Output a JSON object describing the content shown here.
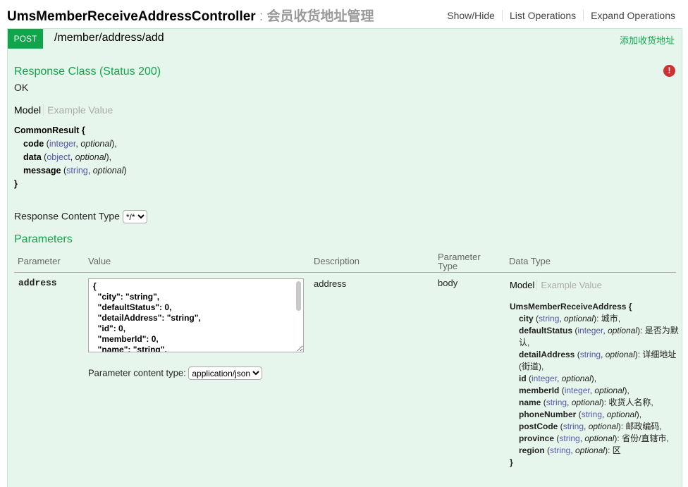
{
  "header": {
    "controller": "UmsMemberReceiveAddressController",
    "separator": " : ",
    "description": "会员收货地址管理",
    "links": [
      "Show/Hide",
      "List Operations",
      "Expand Operations"
    ]
  },
  "operation": {
    "method": "POST",
    "path": "/member/address/add",
    "summary": "添加收货地址"
  },
  "response": {
    "heading": "Response Class (Status 200)",
    "status_text": "OK",
    "tabs": [
      "Model",
      "Example Value"
    ],
    "model_name": "CommonResult {",
    "fields": [
      {
        "name": "code",
        "type": "integer",
        "opt": "optional",
        "end": "),"
      },
      {
        "name": "data",
        "type": "object",
        "opt": "optional",
        "end": "),"
      },
      {
        "name": "message",
        "type": "string",
        "opt": "optional",
        "end": ")"
      }
    ],
    "close": "}",
    "content_type_label": "Response Content Type",
    "content_type_value": "*/*"
  },
  "parameters": {
    "heading": "Parameters",
    "columns": [
      "Parameter",
      "Value",
      "Description",
      "Parameter Type",
      "Data Type"
    ],
    "param_name": "address",
    "value_text": "{\n  \"city\": \"string\",\n  \"defaultStatus\": 0,\n  \"detailAddress\": \"string\",\n  \"id\": 0,\n  \"memberId\": 0,\n  \"name\": \"string\",\n  \"phoneNumber\": \"string\",\n  \"postCode\": \"string\",\n  \"province\": \"string\",\n  \"region\": \"string\"\n}",
    "content_type_label": "Parameter content type:",
    "content_type_value": "application/json",
    "description": "address",
    "param_type": "body",
    "datatype_tabs": [
      "Model",
      "Example Value"
    ],
    "datatype_model": "UmsMemberReceiveAddress {",
    "datatype_fields": [
      {
        "name": "city",
        "type": "string",
        "opt": "optional",
        "desc": "): 城市,"
      },
      {
        "name": "defaultStatus",
        "type": "integer",
        "opt": "optional",
        "desc": "): 是否为默认,"
      },
      {
        "name": "detailAddress",
        "type": "string",
        "opt": "optional",
        "desc": "): 详细地址(街道),"
      },
      {
        "name": "id",
        "type": "integer",
        "opt": "optional",
        "desc": "),"
      },
      {
        "name": "memberId",
        "type": "integer",
        "opt": "optional",
        "desc": "),"
      },
      {
        "name": "name",
        "type": "string",
        "opt": "optional",
        "desc": "): 收货人名称,"
      },
      {
        "name": "phoneNumber",
        "type": "string",
        "opt": "optional",
        "desc": "),"
      },
      {
        "name": "postCode",
        "type": "string",
        "opt": "optional",
        "desc": "): 邮政编码,"
      },
      {
        "name": "province",
        "type": "string",
        "opt": "optional",
        "desc": "): 省份/直辖市,"
      },
      {
        "name": "region",
        "type": "string",
        "opt": "optional",
        "desc": "): 区"
      }
    ],
    "datatype_close": "}"
  }
}
